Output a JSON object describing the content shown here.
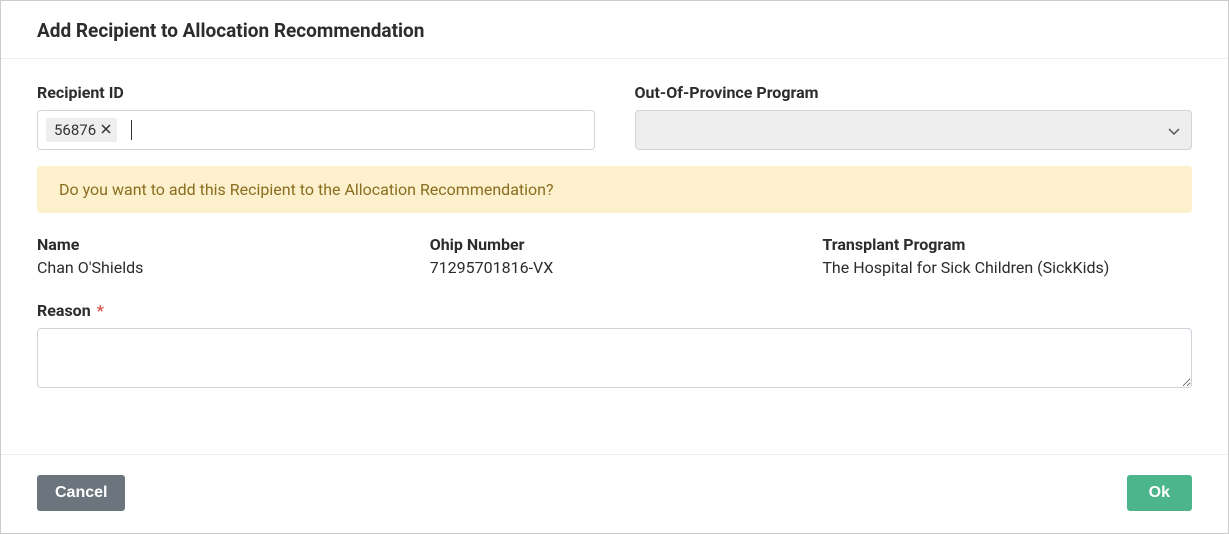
{
  "modal": {
    "title": "Add Recipient to Allocation Recommendation"
  },
  "form": {
    "recipientId": {
      "label": "Recipient ID",
      "tagValue": "56876"
    },
    "outOfProvince": {
      "label": "Out-Of-Province Program",
      "selectedValue": ""
    },
    "reason": {
      "label": "Reason",
      "value": ""
    }
  },
  "alert": {
    "message": "Do you want to add this Recipient to the Allocation Recommendation?"
  },
  "recipient": {
    "nameLabel": "Name",
    "nameValue": "Chan O'Shields",
    "ohipLabel": "Ohip Number",
    "ohipValue": "71295701816-VX",
    "programLabel": "Transplant Program",
    "programValue": "The Hospital for Sick Children (SickKids)"
  },
  "buttons": {
    "cancel": "Cancel",
    "ok": "Ok"
  }
}
